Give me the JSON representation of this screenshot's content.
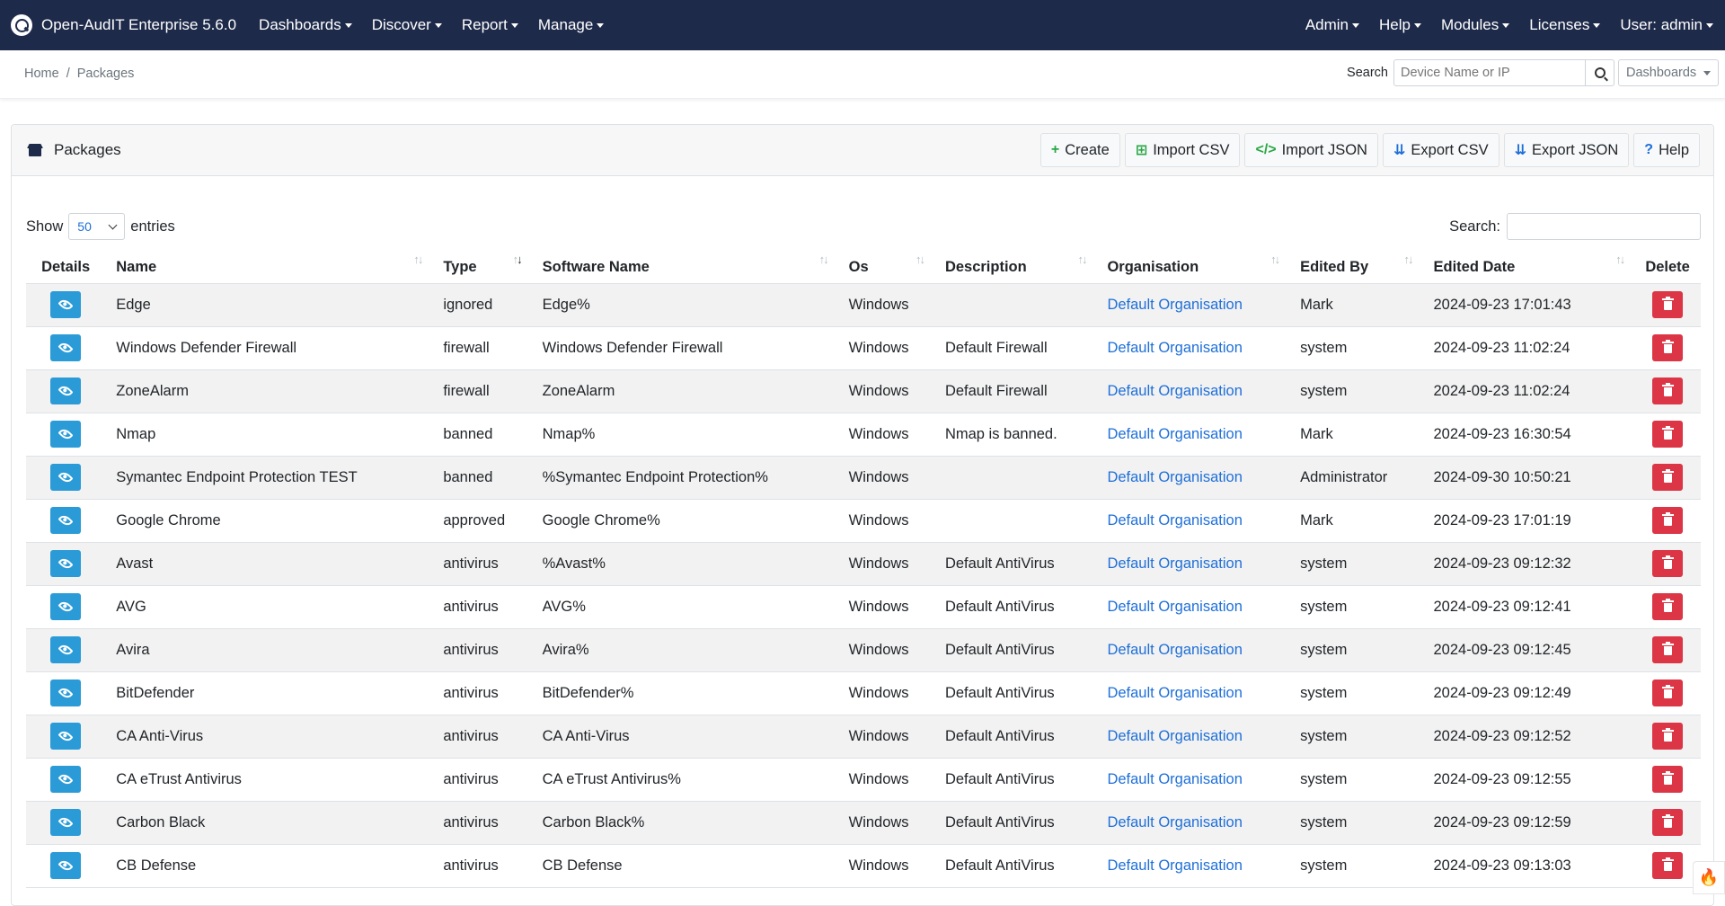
{
  "navbar": {
    "brand": "Open-AudIT Enterprise 5.6.0",
    "left_menu": [
      "Dashboards",
      "Discover",
      "Report",
      "Manage"
    ],
    "right_menu": [
      "Admin",
      "Help",
      "Modules",
      "Licenses",
      "User: admin"
    ],
    "background_color": "#1e2a4a"
  },
  "breadcrumb": {
    "home": "Home",
    "separator": "/",
    "current": "Packages"
  },
  "top_search": {
    "label": "Search",
    "placeholder": "Device Name or IP",
    "select_value": "Dashboards"
  },
  "card": {
    "title": "Packages",
    "buttons": [
      {
        "icon": "plus-icon",
        "glyph": "+",
        "label": "Create"
      },
      {
        "icon": "table-icon",
        "glyph": "⊞",
        "label": "Import CSV"
      },
      {
        "icon": "code-icon",
        "glyph": "</>",
        "label": "Import JSON"
      },
      {
        "icon": "download-icon",
        "glyph": "⇊",
        "label": "Export CSV"
      },
      {
        "icon": "download-icon",
        "glyph": "⇊",
        "label": "Export JSON"
      },
      {
        "icon": "question-icon",
        "glyph": "?",
        "label": "Help"
      }
    ]
  },
  "datatable": {
    "show_label": "Show",
    "entries_value": "50",
    "entries_label": "entries",
    "search_label": "Search:",
    "columns": [
      "Details",
      "Name",
      "Type",
      "Software Name",
      "Os",
      "Description",
      "Organisation",
      "Edited By",
      "Edited Date",
      "Delete"
    ],
    "rows": [
      {
        "name": "Edge",
        "type": "ignored",
        "software_name": "Edge%",
        "os": "Windows",
        "description": "",
        "organisation": "Default Organisation",
        "edited_by": "Mark",
        "edited_date": "2024-09-23 17:01:43"
      },
      {
        "name": "Windows Defender Firewall",
        "type": "firewall",
        "software_name": "Windows Defender Firewall",
        "os": "Windows",
        "description": "Default Firewall",
        "organisation": "Default Organisation",
        "edited_by": "system",
        "edited_date": "2024-09-23 11:02:24"
      },
      {
        "name": "ZoneAlarm",
        "type": "firewall",
        "software_name": "ZoneAlarm",
        "os": "Windows",
        "description": "Default Firewall",
        "organisation": "Default Organisation",
        "edited_by": "system",
        "edited_date": "2024-09-23 11:02:24"
      },
      {
        "name": "Nmap",
        "type": "banned",
        "software_name": "Nmap%",
        "os": "Windows",
        "description": "Nmap is banned.",
        "organisation": "Default Organisation",
        "edited_by": "Mark",
        "edited_date": "2024-09-23 16:30:54"
      },
      {
        "name": "Symantec Endpoint Protection TEST",
        "type": "banned",
        "software_name": "%Symantec Endpoint Protection%",
        "os": "Windows",
        "description": "",
        "organisation": "Default Organisation",
        "edited_by": "Administrator",
        "edited_date": "2024-09-30 10:50:21"
      },
      {
        "name": "Google Chrome",
        "type": "approved",
        "software_name": "Google Chrome%",
        "os": "Windows",
        "description": "",
        "organisation": "Default Organisation",
        "edited_by": "Mark",
        "edited_date": "2024-09-23 17:01:19"
      },
      {
        "name": "Avast",
        "type": "antivirus",
        "software_name": "%Avast%",
        "os": "Windows",
        "description": "Default AntiVirus",
        "organisation": "Default Organisation",
        "edited_by": "system",
        "edited_date": "2024-09-23 09:12:32"
      },
      {
        "name": "AVG",
        "type": "antivirus",
        "software_name": "AVG%",
        "os": "Windows",
        "description": "Default AntiVirus",
        "organisation": "Default Organisation",
        "edited_by": "system",
        "edited_date": "2024-09-23 09:12:41"
      },
      {
        "name": "Avira",
        "type": "antivirus",
        "software_name": "Avira%",
        "os": "Windows",
        "description": "Default AntiVirus",
        "organisation": "Default Organisation",
        "edited_by": "system",
        "edited_date": "2024-09-23 09:12:45"
      },
      {
        "name": "BitDefender",
        "type": "antivirus",
        "software_name": "BitDefender%",
        "os": "Windows",
        "description": "Default AntiVirus",
        "organisation": "Default Organisation",
        "edited_by": "system",
        "edited_date": "2024-09-23 09:12:49"
      },
      {
        "name": "CA Anti-Virus",
        "type": "antivirus",
        "software_name": "CA Anti-Virus",
        "os": "Windows",
        "description": "Default AntiVirus",
        "organisation": "Default Organisation",
        "edited_by": "system",
        "edited_date": "2024-09-23 09:12:52"
      },
      {
        "name": "CA eTrust Antivirus",
        "type": "antivirus",
        "software_name": "CA eTrust Antivirus%",
        "os": "Windows",
        "description": "Default AntiVirus",
        "organisation": "Default Organisation",
        "edited_by": "system",
        "edited_date": "2024-09-23 09:12:55"
      },
      {
        "name": "Carbon Black",
        "type": "antivirus",
        "software_name": "Carbon Black%",
        "os": "Windows",
        "description": "Default AntiVirus",
        "organisation": "Default Organisation",
        "edited_by": "system",
        "edited_date": "2024-09-23 09:12:59"
      },
      {
        "name": "CB Defense",
        "type": "antivirus",
        "software_name": "CB Defense",
        "os": "Windows",
        "description": "Default AntiVirus",
        "organisation": "Default Organisation",
        "edited_by": "system",
        "edited_date": "2024-09-23 09:13:03"
      }
    ]
  },
  "colors": {
    "view_button": "#2b9bd8",
    "delete_button": "#dc3545",
    "link": "#1e6fd9"
  }
}
